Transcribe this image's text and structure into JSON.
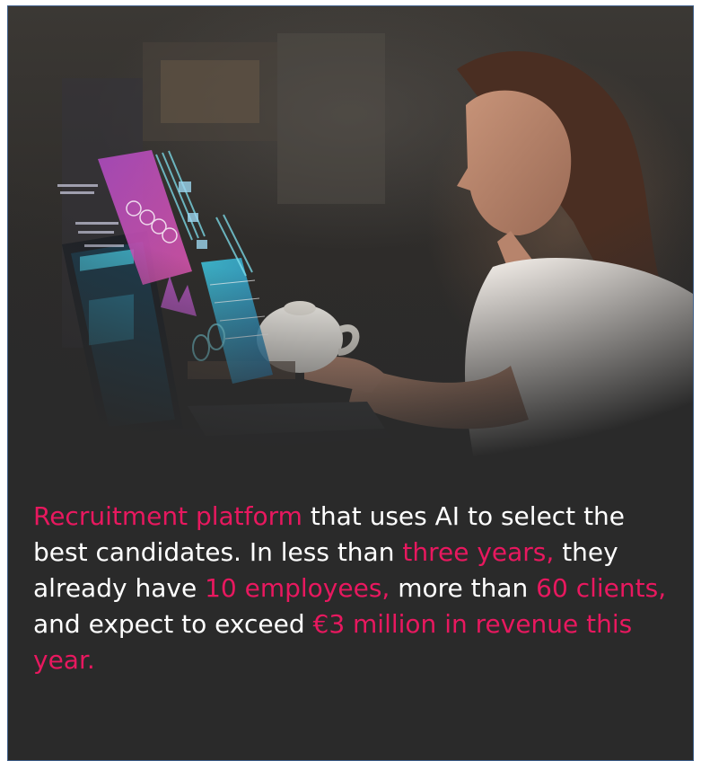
{
  "caption": {
    "part1": "Recruitment platform",
    "part2": " that uses AI to select the best candidates. In less than ",
    "part3": "three years,",
    "part4": " they already have ",
    "part5": "10 employees,",
    "part6": " more than ",
    "part7": "60 clients,",
    "part8": " and expect to exceed ",
    "part9": "€3 million in revenue this year."
  },
  "colors": {
    "background": "#2a2a2a",
    "highlight": "#e8185f",
    "text": "#ffffff",
    "border": "#3f5f8a"
  },
  "image": {
    "subject": "woman-working-on-laptop-with-holographic-ai-dashboards"
  }
}
